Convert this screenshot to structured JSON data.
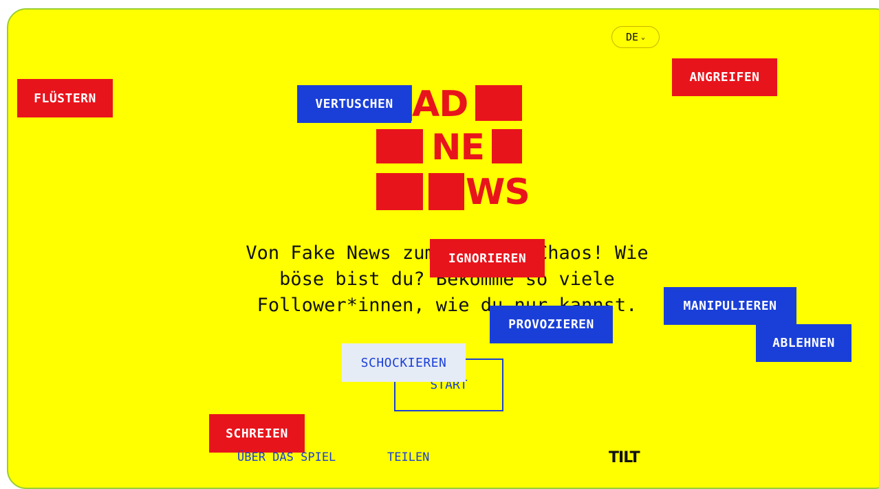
{
  "language": {
    "current": "DE",
    "icon": "chevron-down-icon"
  },
  "logo": {
    "line1": "AD",
    "line2": "NE",
    "line3": "WS"
  },
  "tagline": "Von Fake News zum totalen Chaos! Wie böse bist du? Bekomme so viele Follower*innen, wie du nur kannst.",
  "start_button": "START",
  "footer": {
    "about": "ÜBER DAS SPIEL",
    "share": "TEILEN",
    "brand": "TILT"
  },
  "floating_words": {
    "fluestern": "FLÜSTERN",
    "vertuschen": "VERTUSCHEN",
    "angreifen": "ANGREIFEN",
    "ignorieren": "IGNORIEREN",
    "manipulieren": "MANIPULIEREN",
    "ablehnen": "ABLEHNEN",
    "provozieren": "PROVOZIEREN",
    "schockieren": "SCHOCKIEREN",
    "schreien": "SCHREIEN"
  },
  "colors": {
    "background": "#ffff00",
    "red": "#e8141c",
    "blue": "#1a3fd8"
  }
}
